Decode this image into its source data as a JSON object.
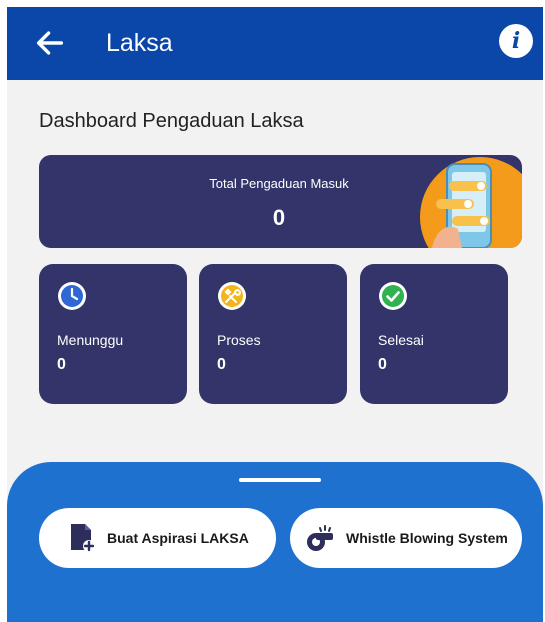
{
  "appbar": {
    "title": "Laksa",
    "back_icon": "arrow-left-icon",
    "info_icon": "info-icon",
    "info_glyph": "i",
    "background": "#0a47a8"
  },
  "dashboard": {
    "heading": "Dashboard Pengaduan Laksa",
    "total": {
      "label": "Total Pengaduan Masuk",
      "value": "0"
    },
    "stats": [
      {
        "label": "Menunggu",
        "value": "0",
        "icon": "clock-icon",
        "color": "#2f67d6"
      },
      {
        "label": "Proses",
        "value": "0",
        "icon": "tools-icon",
        "color": "#f2b51c"
      },
      {
        "label": "Selesai",
        "value": "0",
        "icon": "check-circle-icon",
        "color": "#2fb24f"
      }
    ],
    "card_color": "#32346a"
  },
  "bottom_sheet": {
    "background": "#1f71d0",
    "actions": [
      {
        "label": "Buat Aspirasi LAKSA",
        "icon": "document-add-icon"
      },
      {
        "label": "Whistle Blowing System",
        "icon": "whistle-icon"
      }
    ]
  }
}
